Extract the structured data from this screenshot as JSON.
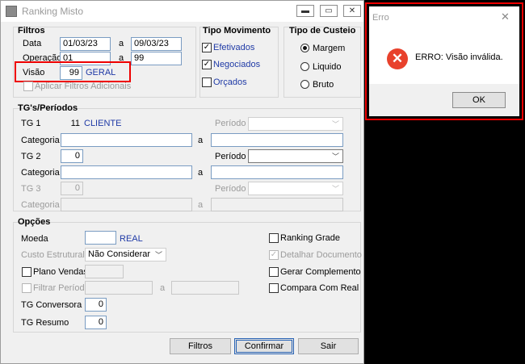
{
  "window": {
    "title": "Ranking Misto",
    "min_icon": "minimize-icon",
    "max_icon": "maximize-icon",
    "close_icon": "close-icon"
  },
  "filtros": {
    "title": "Filtros",
    "data_label": "Data",
    "data_from": "01/03/23",
    "data_a": "a",
    "data_to": "09/03/23",
    "operacao_label": "Operação",
    "operacao_from": "01",
    "operacao_a": "a",
    "operacao_to": "99",
    "visao_label": "Visão",
    "visao_value": "99",
    "visao_desc": "GERAL",
    "aplicar_label": "Aplicar Filtros Adicionais"
  },
  "tipo_movimento": {
    "title": "Tipo Movimento",
    "items": [
      {
        "label": "Efetivados",
        "checked": true
      },
      {
        "label": "Negociados",
        "checked": true
      },
      {
        "label": "Orçados",
        "checked": false
      }
    ]
  },
  "tipo_custeio": {
    "title": "Tipo de Custeio",
    "items": [
      {
        "label": "Margem",
        "selected": true
      },
      {
        "label": "Liquido",
        "selected": false
      },
      {
        "label": "Bruto",
        "selected": false
      }
    ]
  },
  "tgs": {
    "title": "TG's/Períodos",
    "tg1_label": "TG 1",
    "tg1_value": "11",
    "tg1_desc": "CLIENTE",
    "periodo_label": "Período",
    "categoria_label": "Categoria",
    "a": "a",
    "tg2_label": "TG 2",
    "tg2_value": "0",
    "tg3_label": "TG 3",
    "tg3_value": "0"
  },
  "opcoes": {
    "title": "Opções",
    "moeda_label": "Moeda",
    "moeda_desc": "REAL",
    "custo_label": "Custo Estrutural",
    "custo_value": "Não Considerar",
    "plano_label": "Plano Vendas",
    "filtrar_label": "Filtrar Período",
    "a": "a",
    "tg_conversora_label": "TG Conversora",
    "tg_conversora_value": "0",
    "tg_resumo_label": "TG Resumo",
    "tg_resumo_value": "0",
    "ranking_grade_label": "Ranking Grade",
    "detalhar_label": "Detalhar Documento",
    "gerar_label": "Gerar Complemento",
    "compara_label": "Compara Com Real"
  },
  "buttons": {
    "filtros": "Filtros",
    "confirmar": "Confirmar",
    "sair": "Sair"
  },
  "dialog": {
    "title": "Erro",
    "message": "ERRO: Visão inválida.",
    "ok": "OK",
    "close_icon": "close-icon"
  },
  "colors": {
    "error_red": "#e8412c",
    "highlight_red": "#e00000",
    "label_blue": "#1f3aa6"
  }
}
